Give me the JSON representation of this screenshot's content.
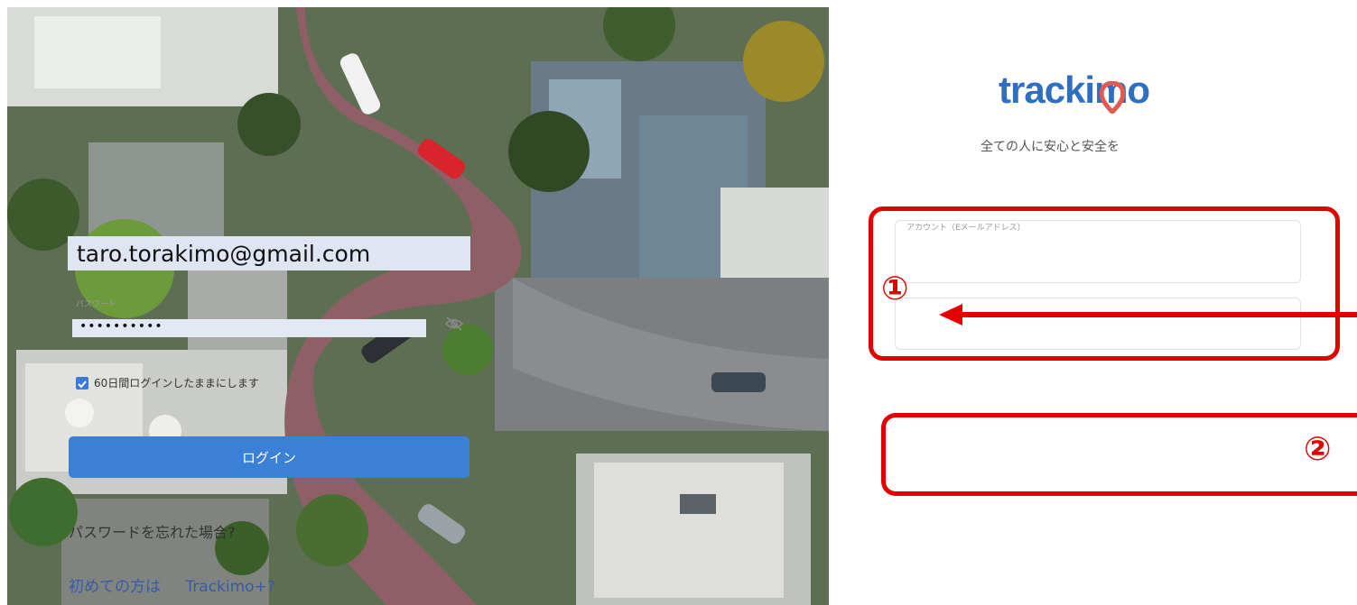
{
  "brand": {
    "logo_text": "trackimo",
    "tagline": "全ての人に安心と安全を",
    "accent_color": "#2f6fc1",
    "pin_color": "#e35a4f"
  },
  "login_form": {
    "account_label": "アカウント（Eメールアドレス）",
    "account_value": "taro.torakimo@gmail.com",
    "password_label": "パスワード",
    "password_value": "••••••••••",
    "password_toggle_icon": "eye-slash-icon",
    "remember_checked": true,
    "remember_label": "60日間ログインしたままにします",
    "login_button_label": "ログイン",
    "forgot_password_link": "パスワードを忘れた場合?",
    "signup_prefix": "初めての方は",
    "signup_link": "Trackimo+?"
  },
  "annotations": {
    "step1_label": "①",
    "step2_label": "②",
    "color": "#e30000"
  },
  "background_image": "aerial-photo-of-winding-street"
}
